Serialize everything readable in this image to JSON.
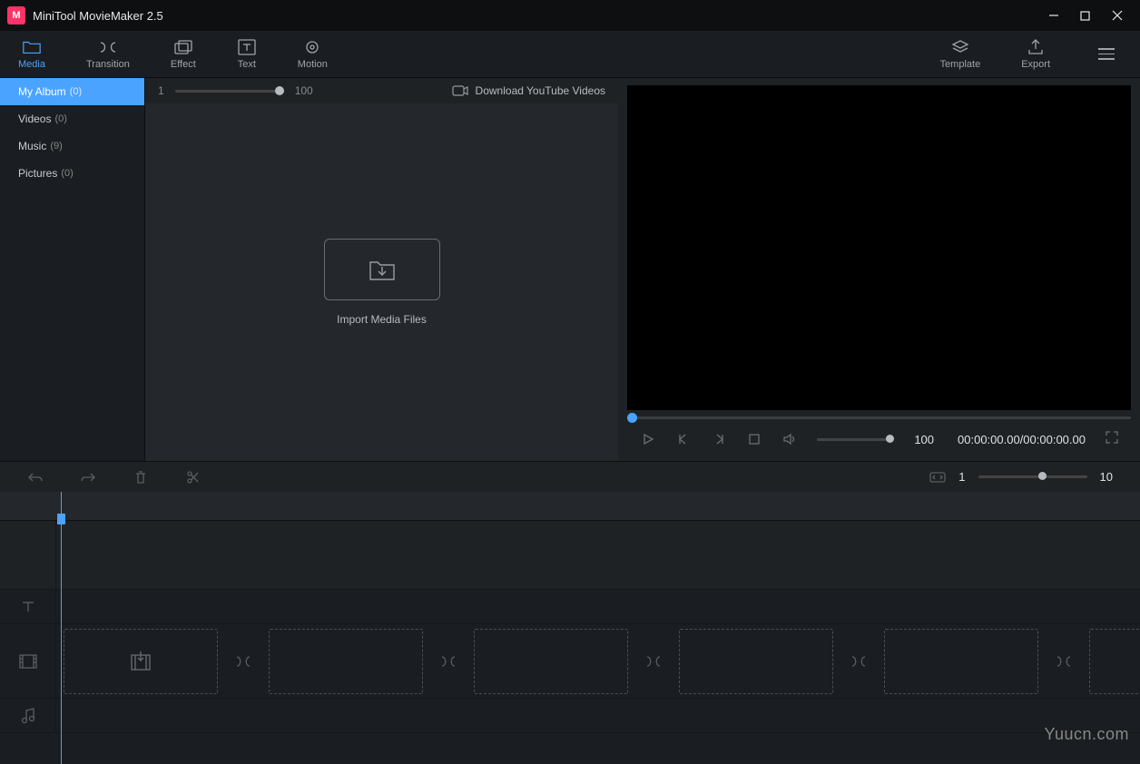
{
  "app": {
    "title": "MiniTool MovieMaker 2.5",
    "logo_text": "M"
  },
  "toolbar": {
    "items": [
      {
        "id": "media",
        "label": "Media",
        "active": true
      },
      {
        "id": "transition",
        "label": "Transition",
        "active": false
      },
      {
        "id": "effect",
        "label": "Effect",
        "active": false
      },
      {
        "id": "text",
        "label": "Text",
        "active": false
      },
      {
        "id": "motion",
        "label": "Motion",
        "active": false
      }
    ],
    "right": [
      {
        "id": "template",
        "label": "Template"
      },
      {
        "id": "export",
        "label": "Export"
      }
    ]
  },
  "sidebar": {
    "items": [
      {
        "label": "My Album",
        "count": "(0)",
        "active": true
      },
      {
        "label": "Videos",
        "count": "(0)",
        "active": false
      },
      {
        "label": "Music",
        "count": "(9)",
        "active": false
      },
      {
        "label": "Pictures",
        "count": "(0)",
        "active": false
      }
    ]
  },
  "media_panel": {
    "zoom_min": "1",
    "zoom_max": "100",
    "download_label": "Download YouTube Videos",
    "import_label": "Import Media Files"
  },
  "preview": {
    "volume": "100",
    "timecode": "00:00:00.00/00:00:00.00"
  },
  "timeline_toolbar": {
    "zoom_min": "1",
    "zoom_max": "10"
  },
  "watermark": "Yuucn.com"
}
